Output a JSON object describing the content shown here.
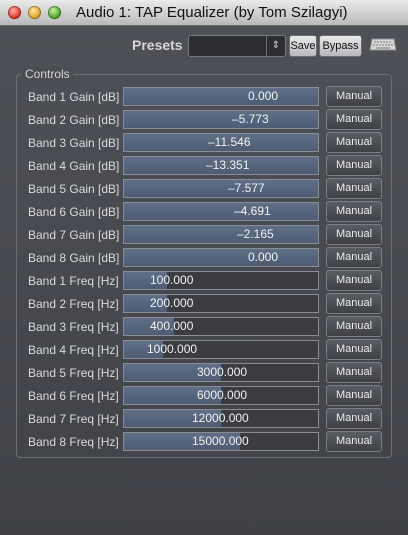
{
  "window": {
    "title": "Audio 1: TAP Equalizer (by Tom Szilagyi)"
  },
  "toolbar": {
    "presets_label": "Presets",
    "presets_value": "",
    "save_label": "Save",
    "bypass_label": "Bypass"
  },
  "controls": {
    "group_label": "Controls",
    "manual_label": "Manual",
    "rows": [
      {
        "label": "Band 1 Gain [dB]",
        "value": "0.000",
        "fill": 1.0
      },
      {
        "label": "Band 2 Gain [dB]",
        "value": "–5.773",
        "fill": 1.0
      },
      {
        "label": "Band 3 Gain [dB]",
        "value": "–11.546",
        "fill": 1.0
      },
      {
        "label": "Band 4 Gain [dB]",
        "value": "–13.351",
        "fill": 1.0
      },
      {
        "label": "Band 5 Gain [dB]",
        "value": "–7.577",
        "fill": 1.0
      },
      {
        "label": "Band 6 Gain [dB]",
        "value": "–4.691",
        "fill": 1.0
      },
      {
        "label": "Band 7 Gain [dB]",
        "value": "–2.165",
        "fill": 1.0
      },
      {
        "label": "Band 8 Gain [dB]",
        "value": "0.000",
        "fill": 1.0
      },
      {
        "label": "Band 1 Freq [Hz]",
        "value": "100.000",
        "fill": 0.22
      },
      {
        "label": "Band 2 Freq [Hz]",
        "value": "200.000",
        "fill": 0.22
      },
      {
        "label": "Band 3 Freq [Hz]",
        "value": "400.000",
        "fill": 0.26
      },
      {
        "label": "Band 4 Freq [Hz]",
        "value": "1000.000",
        "fill": 0.2
      },
      {
        "label": "Band 5 Freq [Hz]",
        "value": "3000.000",
        "fill": 0.5
      },
      {
        "label": "Band 6 Freq [Hz]",
        "value": "6000.000",
        "fill": 0.5
      },
      {
        "label": "Band 7 Freq [Hz]",
        "value": "12000.000",
        "fill": 0.5
      },
      {
        "label": "Band 8 Freq [Hz]",
        "value": "15000.000",
        "fill": 0.6
      }
    ]
  },
  "colors": {
    "background": "#45474d",
    "slider_fill": "#5a6a82",
    "text": "#dadada"
  }
}
